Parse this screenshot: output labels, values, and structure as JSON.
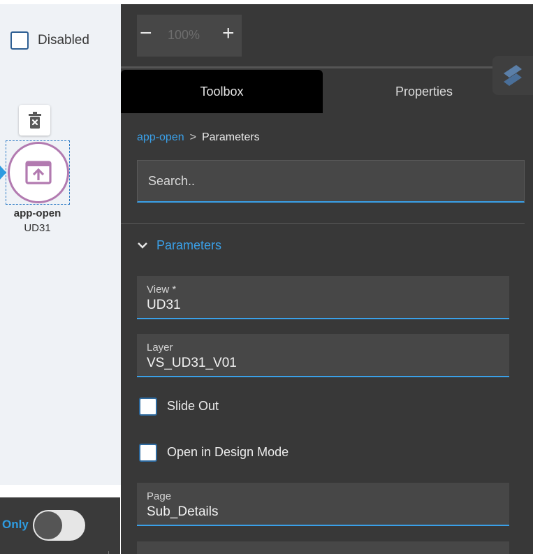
{
  "canvas": {
    "disabled_label": "Disabled",
    "node": {
      "name": "app-open",
      "id": "UD31",
      "icon": "app-open-icon"
    },
    "delete_icon": "trash-x-icon",
    "toggle_label": "Only",
    "toggle_on": false
  },
  "zoom": {
    "minus": "−",
    "value": "100%",
    "plus": "+"
  },
  "tabs": [
    {
      "label": "Toolbox",
      "active": true
    },
    {
      "label": "Properties",
      "active": false
    }
  ],
  "breadcrumb": {
    "link": "app-open",
    "separator": ">",
    "current": "Parameters"
  },
  "search": {
    "placeholder": "Search.."
  },
  "section": {
    "title": "Parameters",
    "expanded": true
  },
  "fields": {
    "view": {
      "label": "View *",
      "value": "UD31"
    },
    "layer": {
      "label": "Layer",
      "value": "VS_UD31_V01"
    },
    "page": {
      "label": "Page",
      "value": "Sub_Details"
    }
  },
  "checkboxes": {
    "slide_out": {
      "label": "Slide Out",
      "checked": false
    },
    "design_mode": {
      "label": "Open in Design Mode",
      "checked": false
    }
  },
  "colors": {
    "accent": "#3aa0e8",
    "panel_bg": "#383838",
    "node_ring": "#b27ab0",
    "canvas_bg": "#eff2f6"
  }
}
